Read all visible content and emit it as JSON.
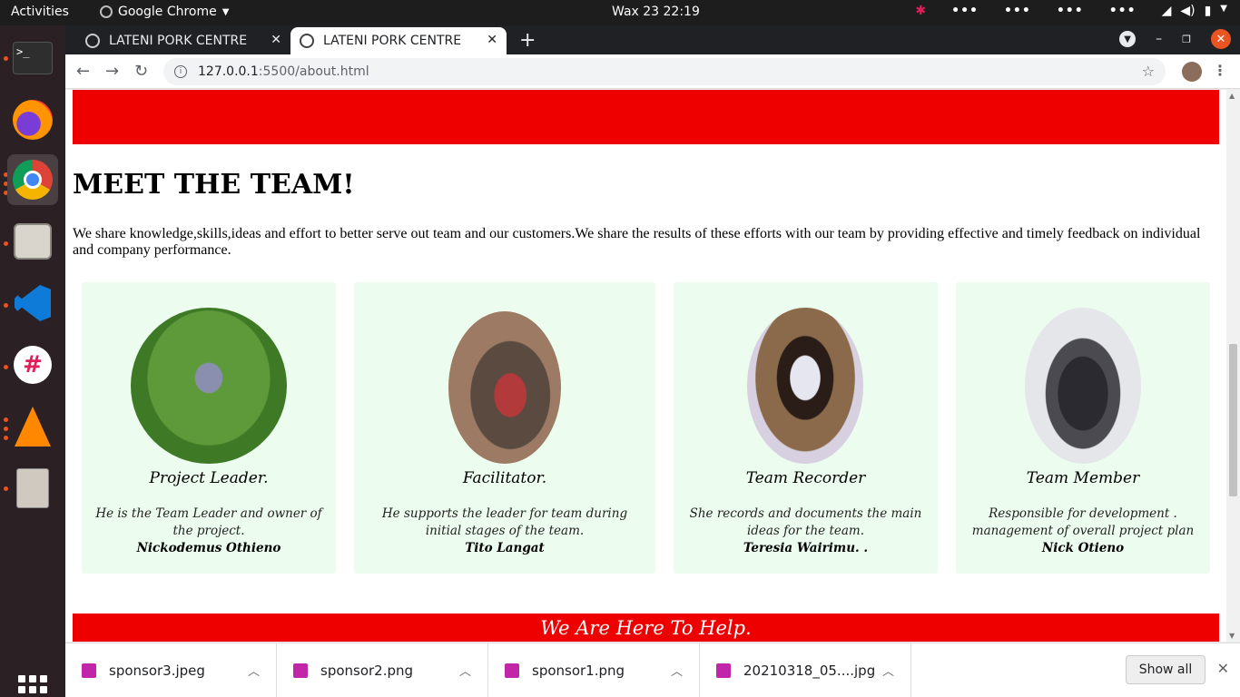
{
  "os": {
    "activities": "Activities",
    "app_name": "Google Chrome",
    "clock": "Wax 23  22:19"
  },
  "browser": {
    "tabs": [
      {
        "label": "LATENI PORK CENTRE",
        "active": false
      },
      {
        "label": "LATENI PORK CENTRE",
        "active": true
      }
    ],
    "url_host": "127.0.0.1",
    "url_rest": ":5500/about.html"
  },
  "page": {
    "heading": "MEET THE TEAM!",
    "intro": "We share knowledge,skills,ideas and effort to better serve out team and our customers.We share the results of these efforts with our team by providing effective and timely feedback on individual and company performance.",
    "team": [
      {
        "role": "Project Leader.",
        "desc": "He is the Team Leader and owner of the project.",
        "name": "Nickodemus Othieno"
      },
      {
        "role": "Facilitator.",
        "desc": "He supports the leader for team during initial stages of the team.",
        "name": "Tito Langat"
      },
      {
        "role": "Team Recorder",
        "desc": "She records and documents the main ideas for the team.",
        "name": "Teresia Wairimu. ."
      },
      {
        "role": "Team Member",
        "desc": "Responsible for development . management of overall project plan",
        "name": "Nick Otieno"
      }
    ],
    "help_banner": "We Are Here To Help."
  },
  "downloads": {
    "items": [
      "sponsor3.jpeg",
      "sponsor2.png",
      "sponsor1.png",
      "20210318_05....jpg"
    ],
    "show_all": "Show all"
  },
  "colors": {
    "accent_red": "#ee0000",
    "card_bg": "#ecfcee"
  }
}
